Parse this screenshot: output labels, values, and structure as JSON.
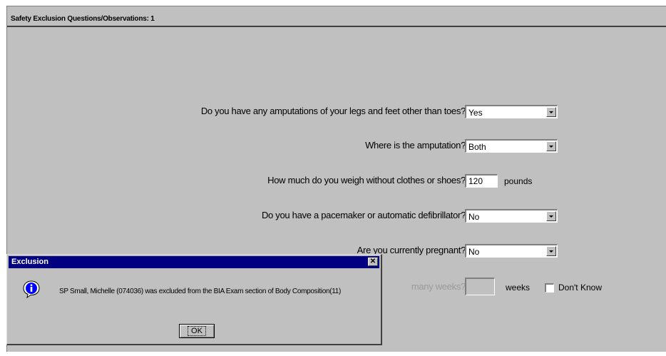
{
  "panel": {
    "title": "Safety Exclusion Questions/Observations: 1"
  },
  "questions": [
    {
      "label": "Do you have any amputations of your legs and feet other than toes?",
      "value": "Yes"
    },
    {
      "label": "Where is the amputation?",
      "value": "Both"
    },
    {
      "label": "How much do you weigh without clothes or shoes?",
      "value": "120",
      "unit": "pounds"
    },
    {
      "label": "Do you have a pacemaker or automatic defibrillator?",
      "value": "No"
    },
    {
      "label": "Are you currently pregnant?",
      "value": "No"
    },
    {
      "label": "many weeks?",
      "value": "",
      "unit": "weeks",
      "checkbox_label": "Don't Know"
    }
  ],
  "dialog": {
    "title": "Exclusion",
    "close_label": "✕",
    "message": "SP Small, Michelle (074036) was excluded from the BIA Exam section of Body Composition(11)",
    "ok_label": "OK"
  },
  "colors": {
    "panel_bg": "#c0c0c0",
    "titlebar": "#000080",
    "info_icon": "#0000ff"
  },
  "icons": {
    "dialog_icon": "info-icon",
    "dropdown_arrow": "chevron-down-icon",
    "close": "close-icon"
  }
}
